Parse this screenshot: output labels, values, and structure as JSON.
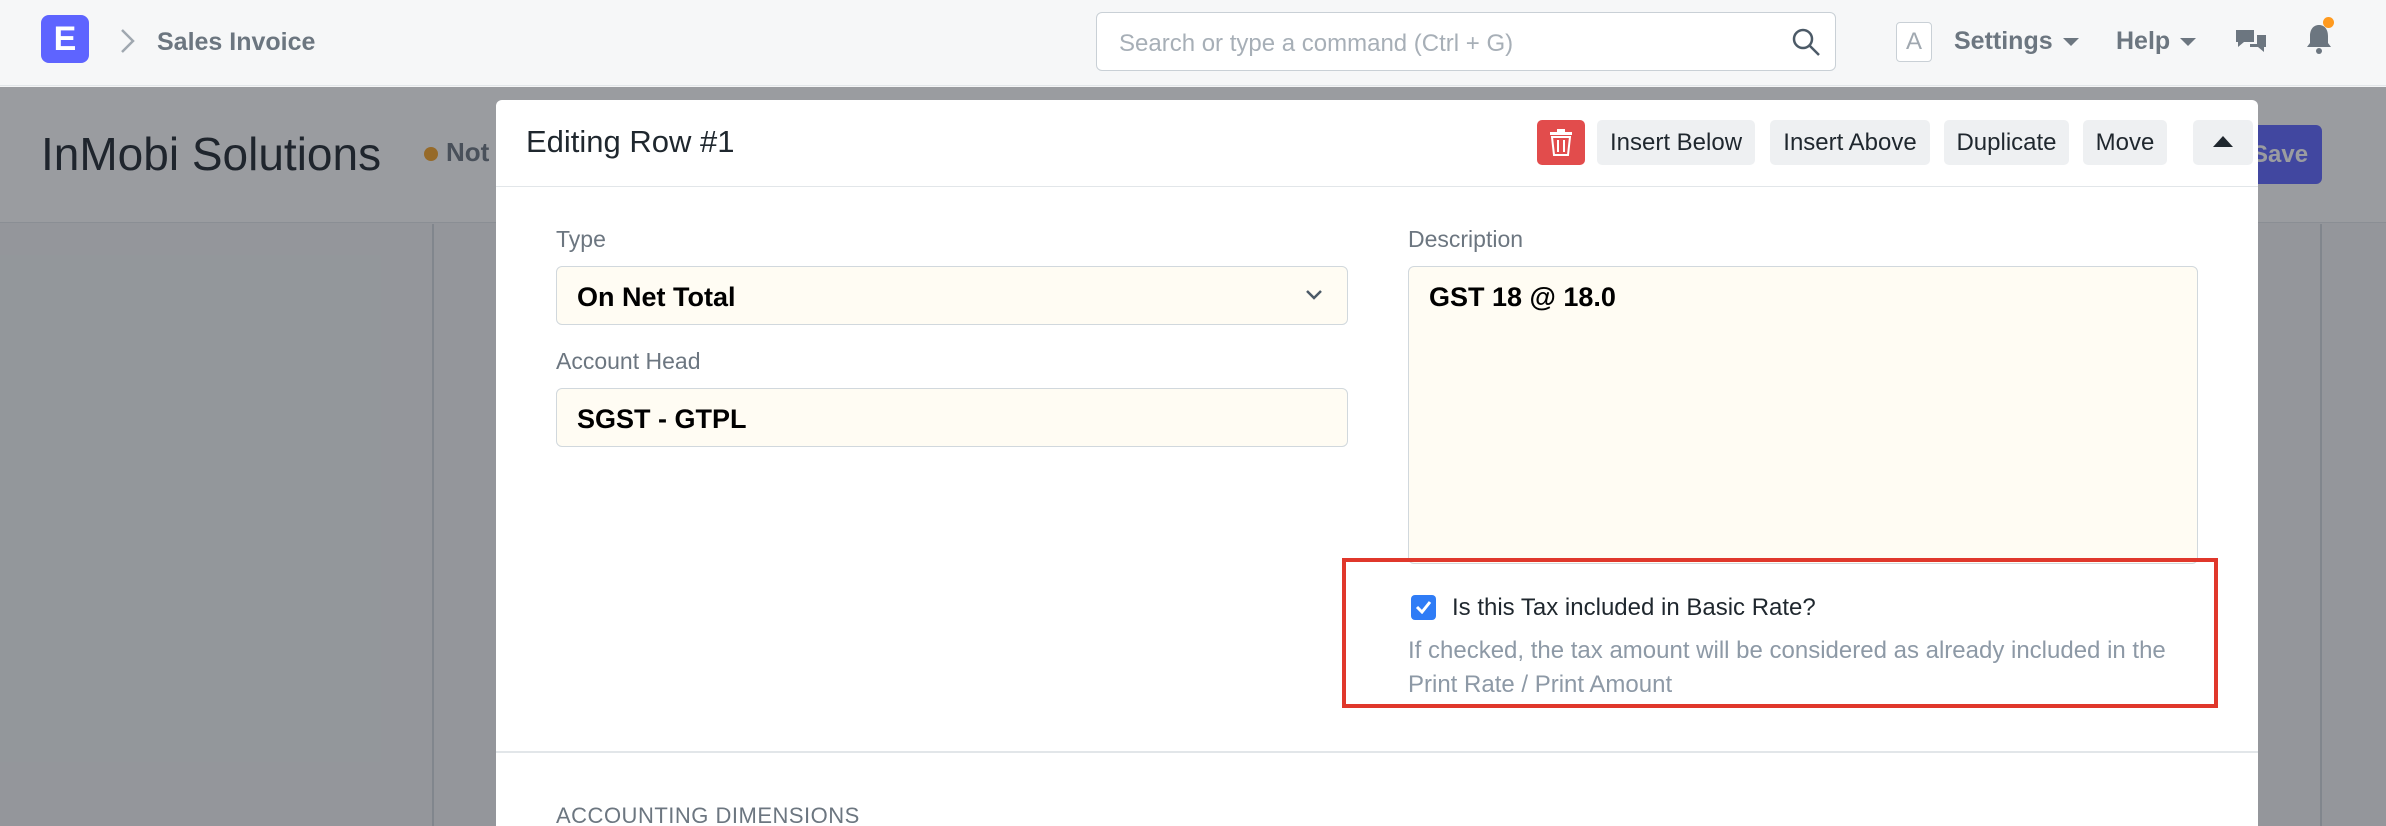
{
  "navbar": {
    "logo_letter": "E",
    "breadcrumb": "Sales Invoice",
    "search_placeholder": "Search or type a command (Ctrl + G)",
    "avatar_letter": "A",
    "settings_label": "Settings",
    "help_label": "Help"
  },
  "page": {
    "title": "InMobi Solutions",
    "status": "Not",
    "save_label": "Save"
  },
  "modal": {
    "title": "Editing Row #1",
    "toolbar": {
      "insert_below": "Insert Below",
      "insert_above": "Insert Above",
      "duplicate": "Duplicate",
      "move": "Move"
    },
    "fields": {
      "type_label": "Type",
      "type_value": "On Net Total",
      "account_head_label": "Account Head",
      "account_head_value": "SGST - GTPL",
      "description_label": "Description",
      "description_value": "GST 18 @ 18.0"
    },
    "tax_included": {
      "checked": true,
      "label": "Is this Tax included in Basic Rate?",
      "help": "If checked, the tax amount will be considered as already included in the Print Rate / Print Amount"
    },
    "section_heading": "ACCOUNTING DIMENSIONS"
  },
  "colors": {
    "brand": "#5e64ff",
    "highlight_box": "#e0372b",
    "delete": "#e24c4c",
    "checkbox": "#2f7cf6",
    "notification_dot": "#ff9a1f"
  }
}
